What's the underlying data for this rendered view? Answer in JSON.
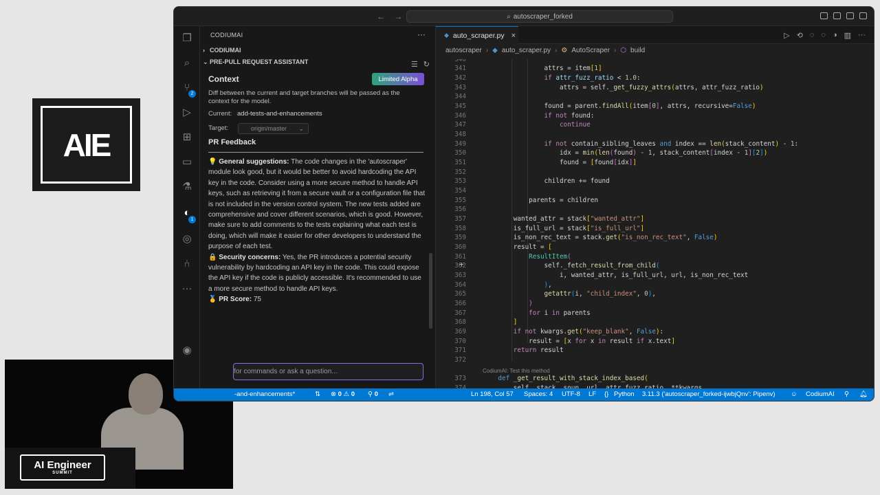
{
  "stage": {
    "logo_text": "AIE",
    "podium_logo_main": "AI Engineer",
    "podium_logo_sub": "SUMMIT"
  },
  "titlebar": {
    "search_text": "autoscraper_forked"
  },
  "activity_badges": {
    "source_control": "2",
    "codiumai": "1"
  },
  "sidebar": {
    "header": "CODIUMAI",
    "section_codiumai": "CODIUMAI",
    "section_assistant": "PRE-PULL REQUEST ASSISTANT",
    "context_title": "Context",
    "badge": "Limited Alpha",
    "context_desc": "Diff between the current and target branches will be passed as the context for the model.",
    "current_label": "Current:",
    "current_value": "add-tests-and-enhancements",
    "target_label": "Target:",
    "target_value": "origin/master",
    "pr_feedback_title": "PR Feedback",
    "general_head": "General suggestions",
    "general_text": "The code changes in the 'autoscraper' module look good, but it would be better to avoid hardcoding the API key in the code. Consider using a more secure method to handle API keys, such as retrieving it from a secure vault or a configuration file that is not included in the version control system. The new tests added are comprehensive and cover different scenarios, which is good. However, make sure to add comments to the tests explaining what each test is doing, which will make it easier for other developers to understand the purpose of each test.",
    "security_head": "Security concerns",
    "security_text": "Yes, the PR introduces a potential security vulnerability by hardcoding an API key in the code. This could expose the API key if the code is publicly accessible. It's recommended to use a more secure method to handle API keys.",
    "score_head": "PR Score",
    "score_value": "75",
    "chat_placeholder": "for commands or ask a question..."
  },
  "editor": {
    "tab_label": "auto_scraper.py",
    "breadcrumb": [
      "autoscraper",
      "auto_scraper.py",
      "AutoScraper",
      "build"
    ],
    "codelens": "CodiumAI: Test this method"
  },
  "statusbar": {
    "branch": "-and-enhancements*",
    "errors": "0",
    "warnings": "0",
    "ports": "0",
    "position": "Ln 198, Col 57",
    "spaces": "Spaces: 4",
    "encoding": "UTF-8",
    "eol": "LF",
    "language": "Python",
    "interpreter": "3.11.3 ('autoscraper_forked-ijwbjQnv': Pipenv)",
    "extension": "CodiumAI"
  },
  "colors": {
    "accent": "#0078d4",
    "badge_gradient_start": "#2fa37a",
    "badge_gradient_end": "#7b4fd6"
  }
}
